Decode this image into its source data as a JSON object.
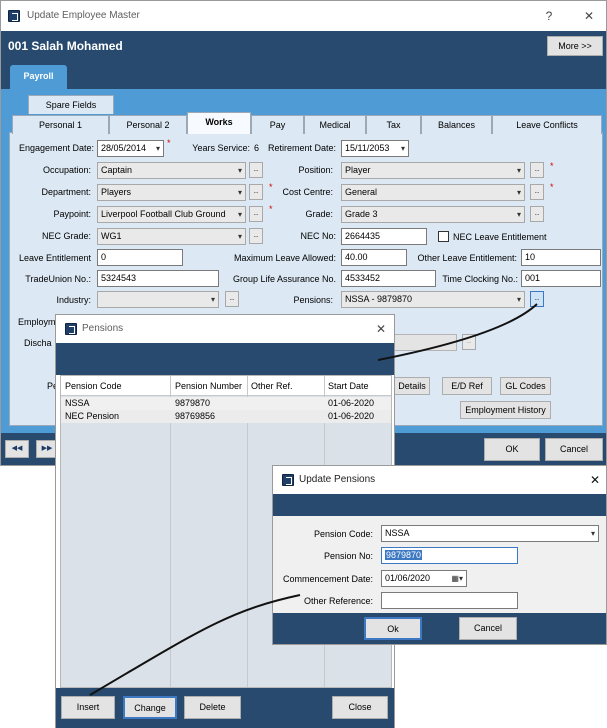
{
  "main_window": {
    "title": "Update Employee Master",
    "help_glyph": "?",
    "close_glyph": "✕",
    "employee_heading": "001 Salah Mohamed",
    "more_button": "More >>",
    "payroll_tab": "Payroll",
    "tabs_top": [
      "Spare Fields"
    ],
    "tabs": [
      "Personal 1",
      "Personal 2",
      "Works",
      "Pay",
      "Medical",
      "Tax",
      "Balances",
      "Leave Conflicts"
    ],
    "active_tab": "Works",
    "fields": {
      "engagement_date_label": "Engagement Date:",
      "engagement_date": "28/05/2014",
      "years_service_label": "Years Service:",
      "years_service": "6",
      "retirement_date_label": "Retirement Date:",
      "retirement_date": "15/11/2053",
      "occupation_label": "Occupation:",
      "occupation": "Captain",
      "position_label": "Position:",
      "position": "Player",
      "department_label": "Department:",
      "department": "Players",
      "cost_centre_label": "Cost Centre:",
      "cost_centre": "General",
      "paypoint_label": "Paypoint:",
      "paypoint": "Liverpool Football Club Ground",
      "grade_label": "Grade:",
      "grade": "Grade 3",
      "nec_grade_label": "NEC Grade:",
      "nec_grade": "WG1",
      "nec_no_label": "NEC No:",
      "nec_no": "2664435",
      "nec_leave_label": "NEC Leave Entitlement",
      "leave_entitlement_label": "Leave Entitlement",
      "leave_entitlement": "0",
      "max_leave_label": "Maximum Leave Allowed:",
      "max_leave": "40.00",
      "other_leave_label": "Other Leave Entitlement:",
      "other_leave": "10",
      "tradeunion_label": "TradeUnion No.:",
      "tradeunion": "5324543",
      "group_life_label": "Group Life Assurance No.",
      "group_life": "4533452",
      "time_clocking_label": "Time Clocking No.:",
      "time_clocking": "001",
      "industry_label": "Industry:",
      "industry": "",
      "pensions_label": "Pensions:",
      "pensions": "NSSA - 9879870",
      "employment_label_partial": "Employme",
      "discharge_label_partial": "Discha",
      "pe_label_partial": "Pe"
    },
    "buttons": {
      "details": "Details",
      "ed_ref": "E/D Ref",
      "gl_codes": "GL Codes",
      "employment_history": "Employment History",
      "ok": "OK",
      "cancel": "Cancel",
      "prev_glyph": "◀◀",
      "next_glyph": "▶▶"
    },
    "ellipsis": ".."
  },
  "pensions_window": {
    "title": "Pensions",
    "close_glyph": "✕",
    "columns": [
      "Pension Code",
      "Pension Number",
      "Other Ref.",
      "Start Date"
    ],
    "rows": [
      [
        "NSSA",
        "9879870",
        "",
        "01-06-2020"
      ],
      [
        "NEC Pension",
        "98769856",
        "",
        "01-06-2020"
      ]
    ],
    "buttons": {
      "insert": "Insert",
      "change": "Change",
      "delete": "Delete",
      "close": "Close"
    }
  },
  "update_pensions_window": {
    "title": "Update Pensions",
    "close_glyph": "✕",
    "pension_code_label": "Pension Code:",
    "pension_code": "NSSA",
    "pension_no_label": "Pension No:",
    "pension_no": "9879870",
    "commencement_label": "Commencement Date:",
    "commencement_date": "01/06/2020",
    "other_ref_label": "Other Reference:",
    "other_ref": "",
    "buttons": {
      "ok": "Ok",
      "cancel": "Cancel"
    }
  },
  "colors": {
    "navy": "#274a6e",
    "tab_panel": "#dce8f3",
    "required": "#d40000",
    "selection": "#3d79c2"
  }
}
